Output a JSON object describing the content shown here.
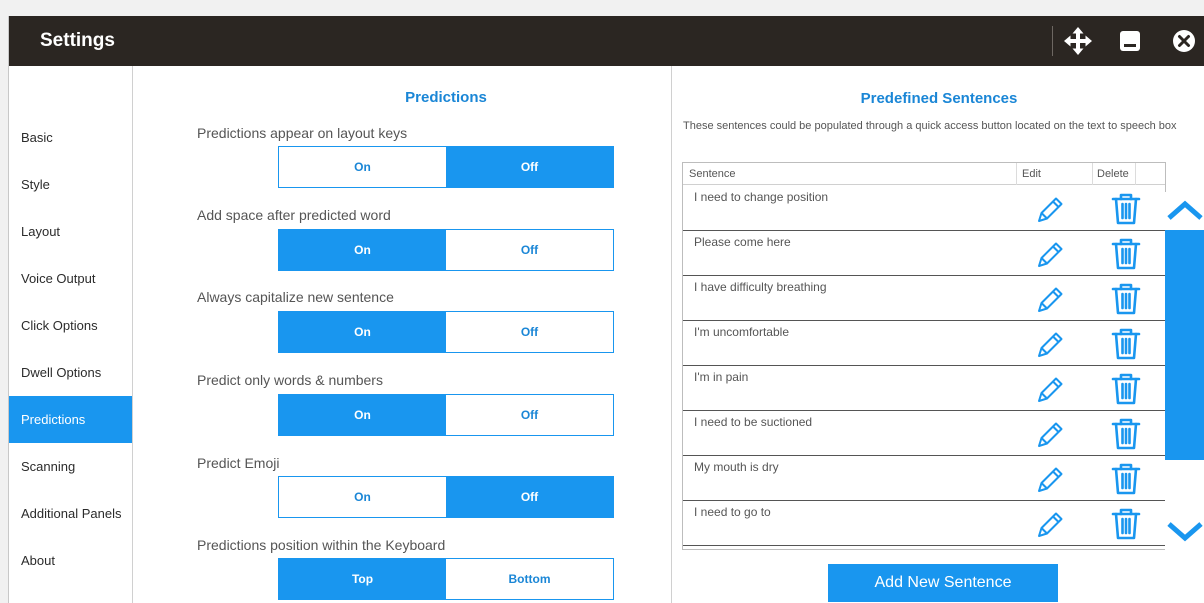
{
  "window": {
    "title": "Settings",
    "controls": [
      {
        "name": "move-icon"
      },
      {
        "name": "minimize-icon"
      },
      {
        "name": "close-icon"
      }
    ]
  },
  "sidebar": {
    "items": [
      {
        "label": "Basic",
        "active": false
      },
      {
        "label": "Style",
        "active": false
      },
      {
        "label": "Layout",
        "active": false
      },
      {
        "label": "Voice Output",
        "active": false
      },
      {
        "label": "Click Options",
        "active": false
      },
      {
        "label": "Dwell Options",
        "active": false
      },
      {
        "label": "Predictions",
        "active": true
      },
      {
        "label": "Scanning",
        "active": false
      },
      {
        "label": "Additional Panels",
        "active": false
      },
      {
        "label": "About",
        "active": false
      }
    ]
  },
  "predictions": {
    "title": "Predictions",
    "options": [
      {
        "label": "Predictions appear on layout keys",
        "left": "On",
        "right": "Off",
        "selected": "right"
      },
      {
        "label": "Add space after predicted word",
        "left": "On",
        "right": "Off",
        "selected": "left"
      },
      {
        "label": "Always capitalize new sentence",
        "left": "On",
        "right": "Off",
        "selected": "left"
      },
      {
        "label": "Predict only words & numbers",
        "left": "On",
        "right": "Off",
        "selected": "left"
      },
      {
        "label": "Predict Emoji",
        "left": "On",
        "right": "Off",
        "selected": "right"
      },
      {
        "label": "Predictions position within the Keyboard",
        "left": "Top",
        "right": "Bottom",
        "selected": "left"
      }
    ]
  },
  "predefined": {
    "title": "Predefined Sentences",
    "description": "These sentences could be populated through a quick access button located on the text to speech box",
    "columns": {
      "sentence": "Sentence",
      "edit": "Edit",
      "delete": "Delete"
    },
    "rows": [
      "I need to change position",
      "Please come here",
      "I have difficulty breathing",
      "I'm uncomfortable",
      "I'm in pain",
      "I need to be suctioned",
      "My mouth is dry",
      "I need to go to"
    ],
    "add_button": "Add New Sentence"
  },
  "colors": {
    "accent": "#1996ef",
    "accent_text": "#1a86d6",
    "titlebar": "#2b2622"
  }
}
